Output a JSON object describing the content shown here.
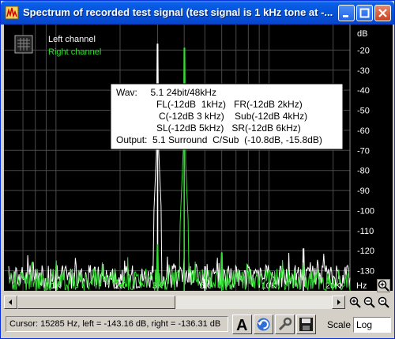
{
  "window": {
    "title": "Spectrum of recorded test signal (test signal is 1 kHz tone at -..."
  },
  "legend": {
    "left": "Left channel",
    "right": "Right channel",
    "left_color": "#ffffff",
    "right_color": "#33dd33"
  },
  "info_box": {
    "lines": [
      "Wav:     5.1 24bit/48kHz",
      "FL(-12dB  1kHz)   FR(-12dB 2kHz)",
      "C(-12dB 3 kHz)    Sub(-12dB 4kHz)",
      "SL(-12dB 5kHz)   SR(-12dB 6kHz)",
      "Output:  5.1 Surround  C/Sub  (-10.8dB, -15.8dB)"
    ]
  },
  "status": {
    "cursor_text": "Cursor:  15285 Hz,  left = -143.16 dB,  right = -136.31 dB",
    "scale_label": "Scale",
    "scale_value": "Log"
  },
  "icons": {
    "font": "font-icon",
    "reset": "refresh-icon",
    "tools": "wrench-icon",
    "save": "save-icon"
  },
  "chart_data": {
    "type": "line",
    "x_scale": "log",
    "xlabel": "Hz",
    "ylabel": "dB",
    "xlim": [
      600,
      24000
    ],
    "ylim": [
      -140,
      -10
    ],
    "x_ticks": [
      1000,
      2000,
      3000,
      5000,
      10000,
      20000
    ],
    "x_tick_labels": [
      "1K",
      "2K",
      "3K",
      "5K",
      "10K",
      "20K",
      "Hz"
    ],
    "y_ticks": [
      -20,
      -30,
      -40,
      -50,
      -60,
      -70,
      -80,
      -90,
      -100,
      -110,
      -120,
      -130
    ],
    "y_tick_labels": [
      "dB",
      "-20",
      "-30",
      "-40",
      "-50",
      "-60",
      "-70",
      "-80",
      "-90",
      "-100",
      "-110",
      "-120",
      "-130"
    ],
    "grid": true,
    "series": [
      {
        "name": "Left channel",
        "color": "#ffffff",
        "peaks": [
          {
            "x": 1000,
            "y": -130
          },
          {
            "x": 3000,
            "y": -17
          },
          {
            "x": 5000,
            "y": -128
          },
          {
            "x": 14500,
            "y": -119
          }
        ],
        "noise_floor": -133
      },
      {
        "name": "Right channel",
        "color": "#33dd33",
        "peaks": [
          {
            "x": 3000,
            "y": -117
          },
          {
            "x": 4000,
            "y": -19
          },
          {
            "x": 6000,
            "y": -121
          },
          {
            "x": 10000,
            "y": -130
          }
        ],
        "noise_floor": -135
      }
    ]
  }
}
